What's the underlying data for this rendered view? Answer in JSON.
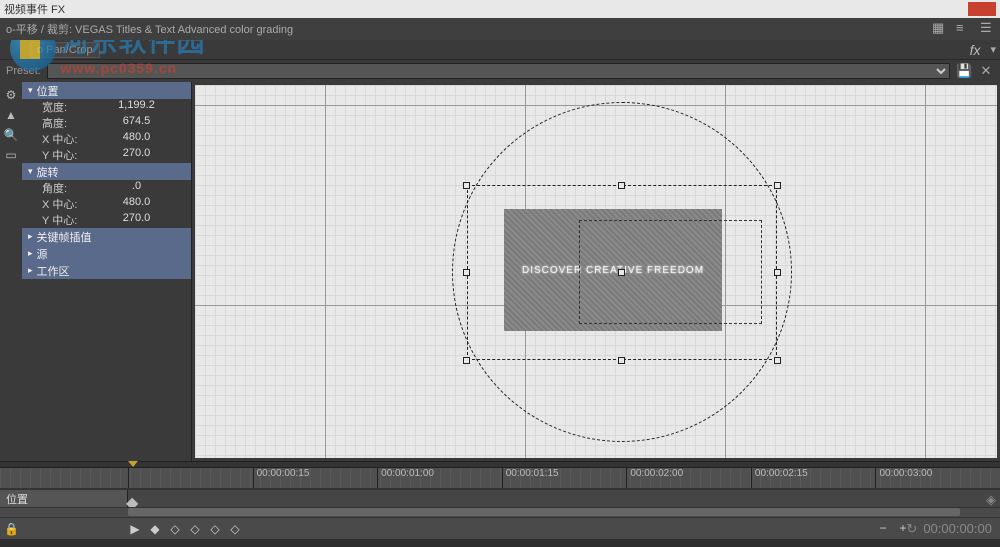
{
  "window": {
    "title": "视频事件 FX"
  },
  "watermark": {
    "name": "河东软件园",
    "url": "www.pc0359.cn"
  },
  "fx": {
    "breadcrumb": "o-平移 / 裁剪: VEGAS Titles & Text Advanced color grading",
    "panCropLabel": "o Pan/Crop",
    "fxlabel": "fx",
    "preset_label": "Preset:"
  },
  "groups": [
    {
      "label": "位置",
      "props": [
        {
          "label": "宽度:",
          "value": "1,199.2"
        },
        {
          "label": "高度:",
          "value": "674.5"
        },
        {
          "label": "X 中心:",
          "value": "480.0"
        },
        {
          "label": "Y 中心:",
          "value": "270.0"
        }
      ]
    },
    {
      "label": "旋转",
      "props": [
        {
          "label": "角度:",
          "value": ".0"
        },
        {
          "label": "X 中心:",
          "value": "480.0"
        },
        {
          "label": "Y 中心:",
          "value": "270.0"
        }
      ]
    },
    {
      "label": "关键帧插值",
      "props": []
    },
    {
      "label": "源",
      "props": []
    },
    {
      "label": "工作区",
      "props": []
    }
  ],
  "canvas": {
    "text": "DISCOVER CREATIVE FREEDOM"
  },
  "timeline": {
    "track": "位置",
    "ticks": [
      "",
      "00:00:00:15",
      "00:00:01:00",
      "00:00:01:15",
      "00:00:02:00",
      "00:00:02:15",
      "00:00:03:00"
    ],
    "readout": "00:00:00:00"
  }
}
